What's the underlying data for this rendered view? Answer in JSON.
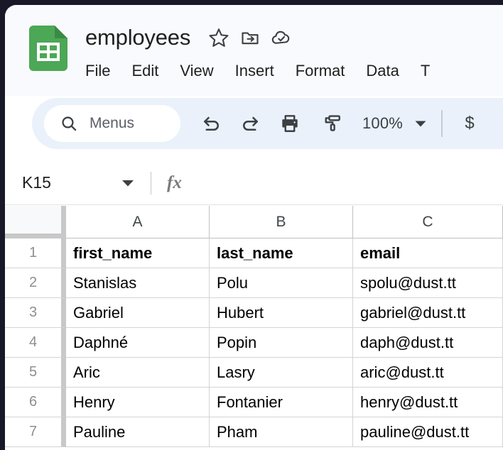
{
  "window": {
    "frame_color": "#181828",
    "surface_color": "#ffffff"
  },
  "header": {
    "doc_icon_name": "sheets-document-icon",
    "doc_icon_color": "#4ca756",
    "title": "employees",
    "icons": [
      {
        "name": "star-icon",
        "label": "Star"
      },
      {
        "name": "move-to-folder-icon",
        "label": "Move"
      },
      {
        "name": "cloud-saved-icon",
        "label": "Saved to Drive"
      }
    ],
    "menus": [
      {
        "label": "File"
      },
      {
        "label": "Edit"
      },
      {
        "label": "View"
      },
      {
        "label": "Insert"
      },
      {
        "label": "Format"
      },
      {
        "label": "Data"
      },
      {
        "label": "T"
      }
    ]
  },
  "toolbar": {
    "background": "#eaf1fb",
    "search": {
      "icon": "search-icon",
      "placeholder": "Menus",
      "value": ""
    },
    "buttons": [
      {
        "name": "undo-button",
        "icon": "undo-icon",
        "label": "Undo"
      },
      {
        "name": "redo-button",
        "icon": "redo-icon",
        "label": "Redo"
      },
      {
        "name": "print-button",
        "icon": "print-icon",
        "label": "Print"
      },
      {
        "name": "paint-format-button",
        "icon": "paint-roller-icon",
        "label": "Paint format"
      }
    ],
    "zoom": {
      "value": "100%",
      "caret": "chevron-down-icon"
    },
    "currency_button_label": "$"
  },
  "formula_bar": {
    "name_box_value": "K15",
    "name_box_caret": "chevron-down-icon",
    "fx_label": "fx",
    "formula_value": ""
  },
  "grid": {
    "columns": [
      "A",
      "B",
      "C"
    ],
    "rows": [
      "1",
      "2",
      "3",
      "4",
      "5",
      "6",
      "7"
    ],
    "cells": [
      [
        "first_name",
        "last_name",
        "email"
      ],
      [
        "Stanislas",
        "Polu",
        "spolu@dust.tt"
      ],
      [
        "Gabriel",
        "Hubert",
        "gabriel@dust.tt"
      ],
      [
        "Daphné",
        "Popin",
        "daph@dust.tt"
      ],
      [
        "Aric",
        "Lasry",
        "aric@dust.tt"
      ],
      [
        "Henry",
        "Fontanier",
        "henry@dust.tt"
      ],
      [
        "Pauline",
        "Pham",
        "pauline@dust.tt"
      ]
    ],
    "header_row_index": 0,
    "selected_cell": "K15"
  }
}
